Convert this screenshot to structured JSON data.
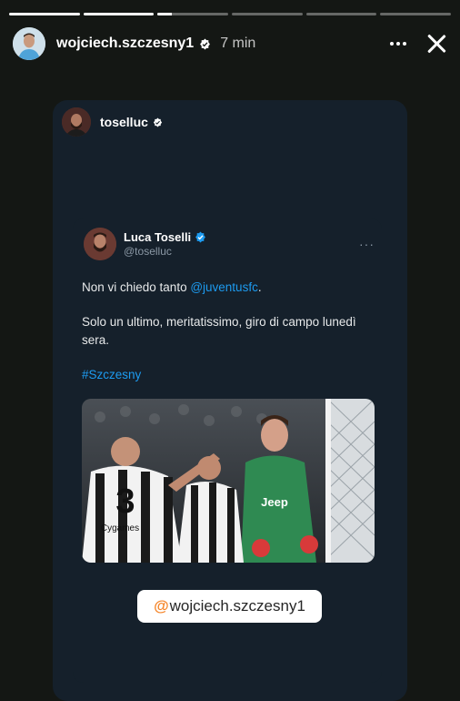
{
  "story": {
    "progress": [
      1,
      1,
      0.2,
      0,
      0,
      0
    ],
    "username": "wojciech.szczesny1",
    "time": "7 min"
  },
  "repost": {
    "username": "toselluc"
  },
  "tweet": {
    "display_name": "Luca Toselli",
    "handle": "@toselluc",
    "line1_prefix": "Non vi chiedo tanto ",
    "line1_mention": "@juventusfc",
    "line1_suffix": ".",
    "line2": "Solo un ultimo, meritatissimo, giro di campo lunedì sera.",
    "hashtag": "#Szczesny",
    "jersey_number": "3",
    "sponsor": "Jeep",
    "sponsor2": "Cygames"
  },
  "mention_sticker": {
    "at": "@",
    "username": "wojciech.szczesny1"
  },
  "colors": {
    "background": "#141714",
    "card": "#15202b",
    "link": "#1d9bf0",
    "verified_blue": "#1d9bf0",
    "goalkeeper_kit": "#2f8a52"
  },
  "icons": [
    "verified-badge-icon",
    "more-options-icon",
    "close-icon"
  ]
}
